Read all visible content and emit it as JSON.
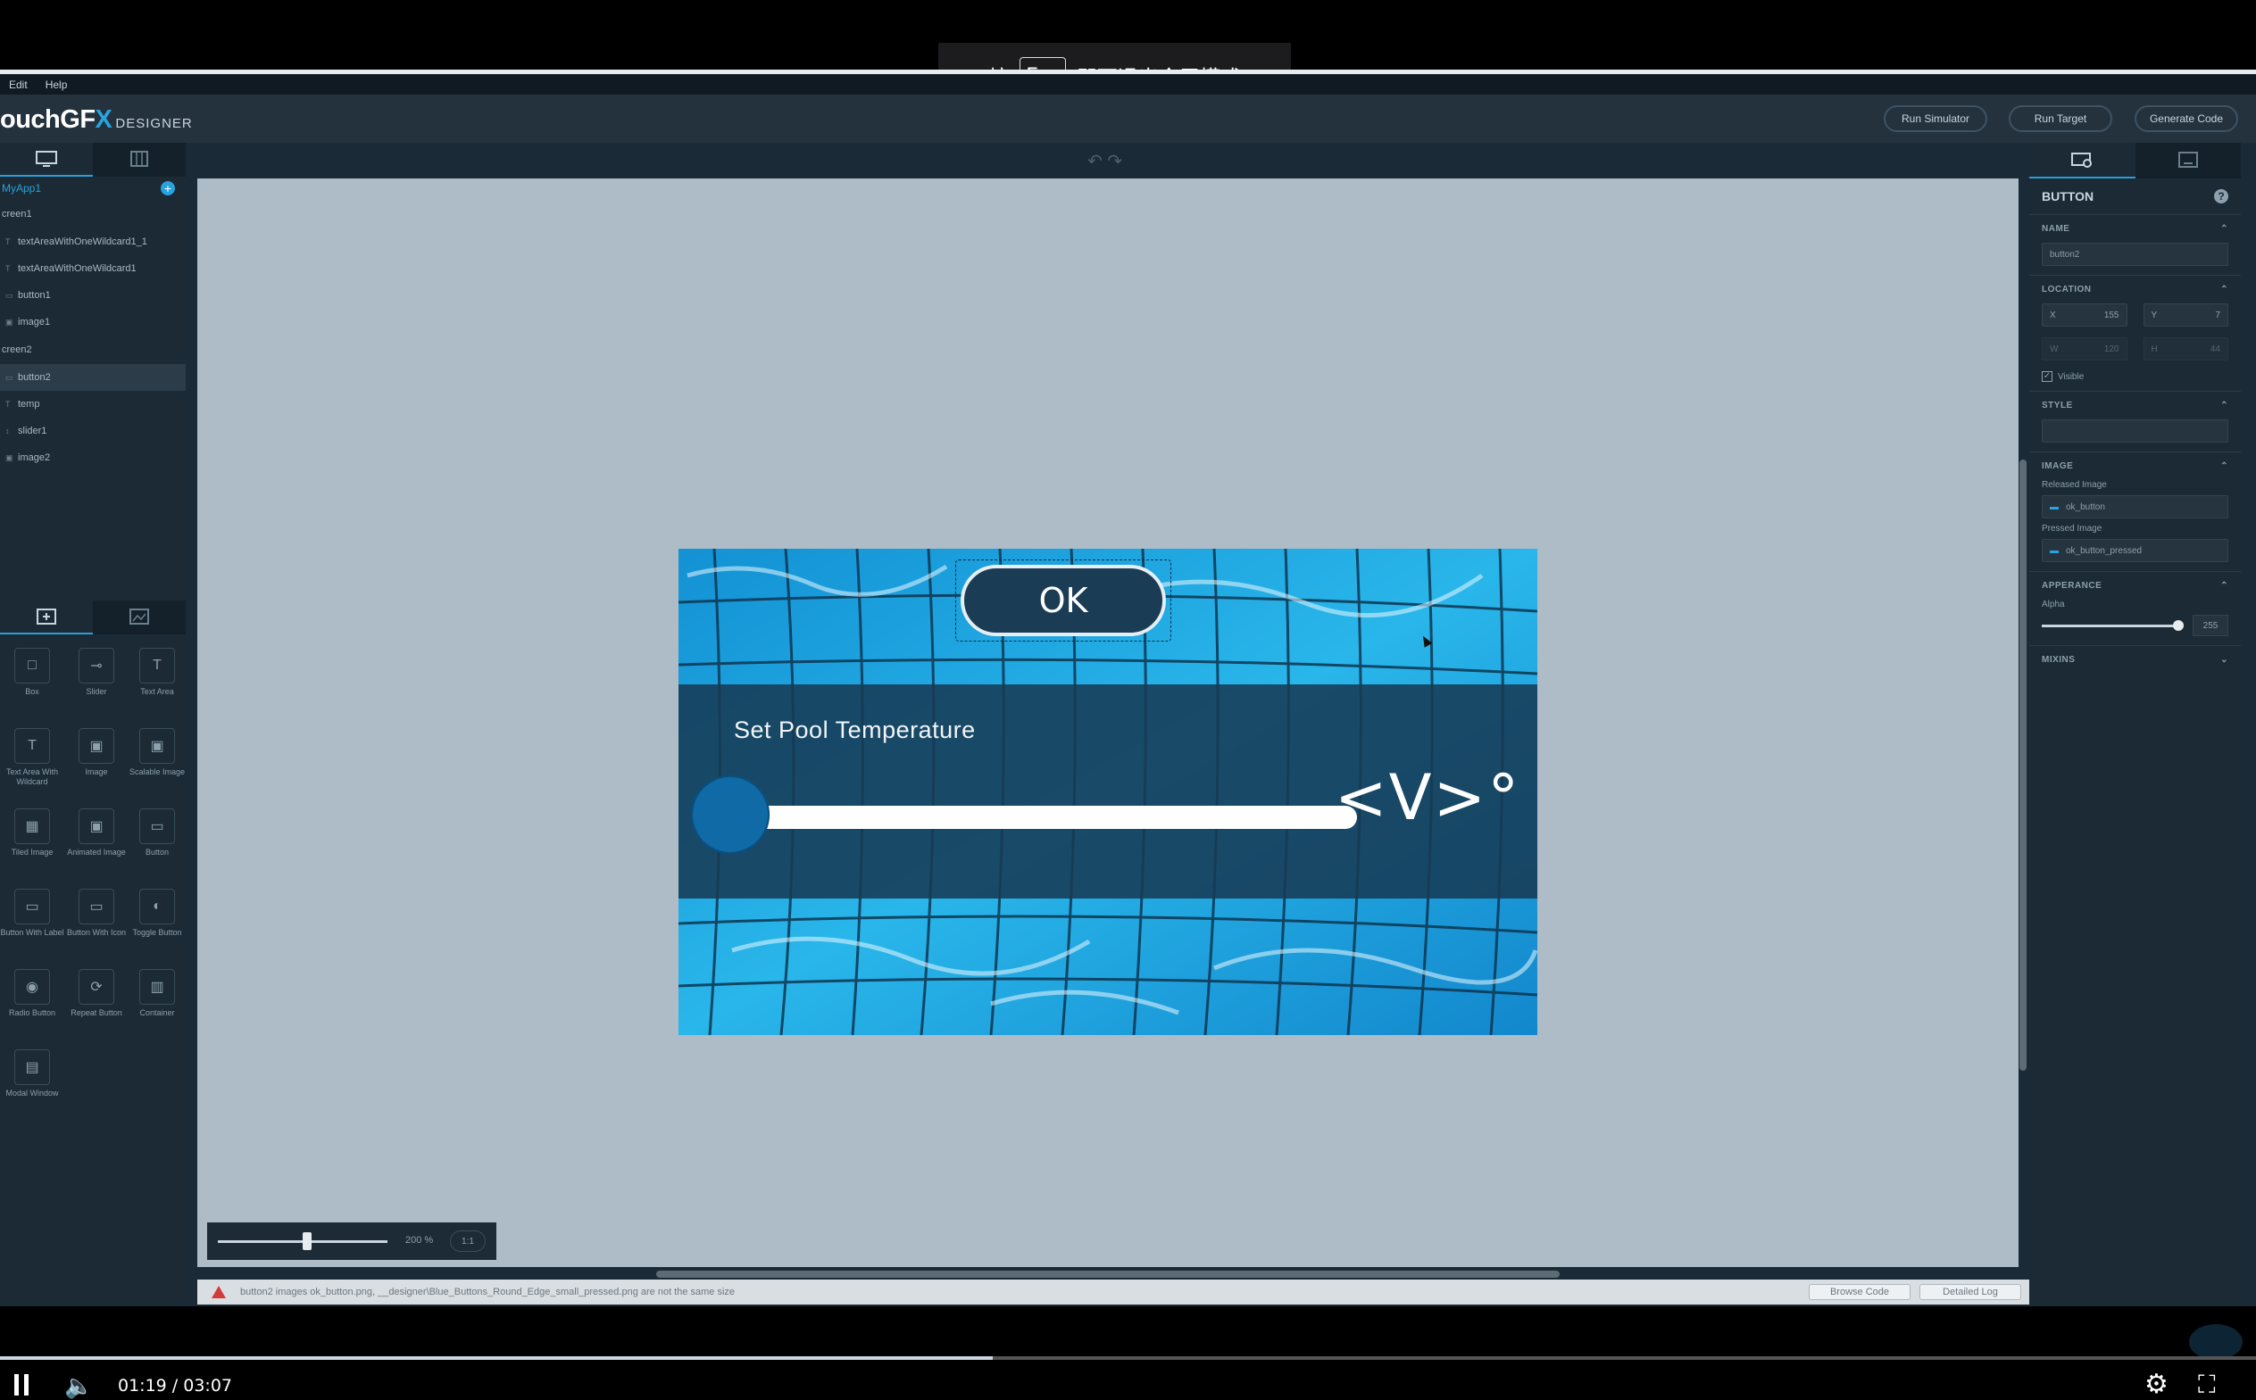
{
  "banner": {
    "prefix": "按",
    "key": "Esc",
    "suffix": "即可退出全屏模式"
  },
  "menu": [
    "Edit",
    "Help"
  ],
  "app": {
    "logo_main": "ouchGF",
    "logo_x": "X",
    "logo_sub": "DESIGNER"
  },
  "header_buttons": {
    "run_simulator": "Run Simulator",
    "run_target": "Run Target",
    "generate_code": "Generate Code"
  },
  "project": {
    "name": "MyApp1"
  },
  "tree": {
    "screen1": "creen1",
    "screen1_items": [
      "textAreaWithOneWildcard1_1",
      "textAreaWithOneWildcard1",
      "button1",
      "image1"
    ],
    "screen2": "creen2",
    "screen2_items": [
      "button2",
      "temp",
      "slider1",
      "image2"
    ]
  },
  "widgets": [
    {
      "label": "Box",
      "icon": "box-icon"
    },
    {
      "label": "Slider",
      "icon": "slider-icon"
    },
    {
      "label": "Text Area",
      "icon": "text-area-icon"
    },
    {
      "label": "Text Area With Wildcard",
      "icon": "text-wildcard-icon"
    },
    {
      "label": "Image",
      "icon": "image-icon"
    },
    {
      "label": "Scalable Image",
      "icon": "scalable-image-icon"
    },
    {
      "label": "Tiled Image",
      "icon": "tiled-image-icon"
    },
    {
      "label": "Animated Image",
      "icon": "animated-image-icon"
    },
    {
      "label": "Button",
      "icon": "button-icon"
    },
    {
      "label": "Button With Label",
      "icon": "button-label-icon"
    },
    {
      "label": "Button With Icon",
      "icon": "button-icon-icon"
    },
    {
      "label": "Toggle Button",
      "icon": "toggle-button-icon"
    },
    {
      "label": "Radio Button",
      "icon": "radio-button-icon"
    },
    {
      "label": "Repeat Button",
      "icon": "repeat-button-icon"
    },
    {
      "label": "Container",
      "icon": "container-icon"
    },
    {
      "label": "Modal Window",
      "icon": "modal-window-icon"
    }
  ],
  "device": {
    "ok_label": "OK",
    "temp_title": "Set Pool Temperature",
    "readout": "<V>°",
    "slider_value": 0
  },
  "canvas": {
    "zoom": "200 %",
    "ratio_btn": "1:1"
  },
  "status": {
    "message": "button2 images ok_button.png, __designer\\Blue_Buttons_Round_Edge_small_pressed.png are not the same size",
    "browse_code": "Browse Code",
    "detailed_log": "Detailed Log"
  },
  "props": {
    "title": "BUTTON",
    "name_label": "NAME",
    "name_value": "button2",
    "location_label": "LOCATION",
    "x_label": "X",
    "x_value": "155",
    "y_label": "Y",
    "y_value": "7",
    "w_label": "W",
    "w_value": "120",
    "h_label": "H",
    "h_value": "44",
    "visible_label": "Visible",
    "style_label": "STYLE",
    "image_label": "IMAGE",
    "released_label": "Released Image",
    "released_value": "ok_button",
    "pressed_label": "Pressed Image",
    "pressed_value": "ok_button_pressed",
    "appearance_label": "APPERANCE",
    "alpha_label": "Alpha",
    "alpha_value": "255",
    "mixins_label": "MIXINS"
  },
  "video": {
    "time": "01:19 / 03:07",
    "progress": 0.44
  },
  "colors": {
    "accent": "#27a3de",
    "panel": "#1b2a35",
    "canvas": "#adbcc6",
    "band": "#173b55"
  }
}
